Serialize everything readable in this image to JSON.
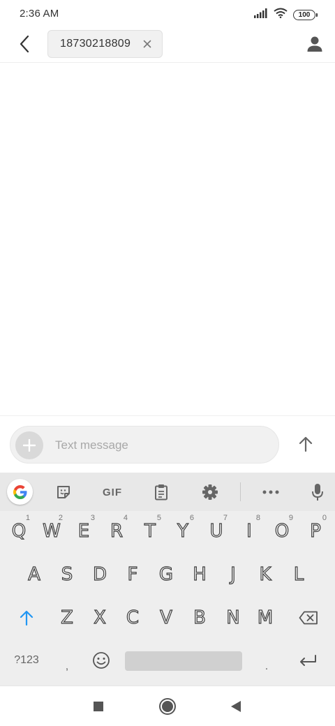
{
  "status_bar": {
    "time": "2:36 AM",
    "battery": "100",
    "icons": [
      "signal-icon",
      "wifi-icon",
      "battery-icon"
    ]
  },
  "header": {
    "back_icon": "back-arrow-icon",
    "recipient": "18730218809",
    "remove_icon": "close-icon",
    "contact_icon": "person-icon"
  },
  "composer": {
    "placeholder": "Text message",
    "value": "",
    "add_icon": "plus-icon",
    "send_icon": "arrow-up-icon"
  },
  "keyboard": {
    "toolbar": {
      "gif_label": "GIF",
      "icons": [
        "google-icon",
        "sticker-icon",
        "gif-icon",
        "clipboard-icon",
        "gear-icon",
        "more-icon",
        "mic-icon"
      ]
    },
    "row1": [
      {
        "label": "Q",
        "hint": "1"
      },
      {
        "label": "W",
        "hint": "2"
      },
      {
        "label": "E",
        "hint": "3"
      },
      {
        "label": "R",
        "hint": "4"
      },
      {
        "label": "T",
        "hint": "5"
      },
      {
        "label": "Y",
        "hint": "6"
      },
      {
        "label": "U",
        "hint": "7"
      },
      {
        "label": "I",
        "hint": "8"
      },
      {
        "label": "O",
        "hint": "9"
      },
      {
        "label": "P",
        "hint": "0"
      }
    ],
    "row2": [
      "A",
      "S",
      "D",
      "F",
      "G",
      "H",
      "J",
      "K",
      "L"
    ],
    "row3": [
      "Z",
      "X",
      "C",
      "V",
      "B",
      "N",
      "M"
    ],
    "symbols_label": "?123",
    "comma": ",",
    "period": ".",
    "colors": {
      "accent": "#2196F3",
      "key_stroke": "#3c3c3c",
      "toolbar_bg": "#e8e8e8",
      "keyboard_bg": "#eeeeee"
    }
  },
  "nav_bar": {
    "icons": [
      "recents-square-icon",
      "home-circle-icon",
      "back-triangle-icon"
    ]
  }
}
